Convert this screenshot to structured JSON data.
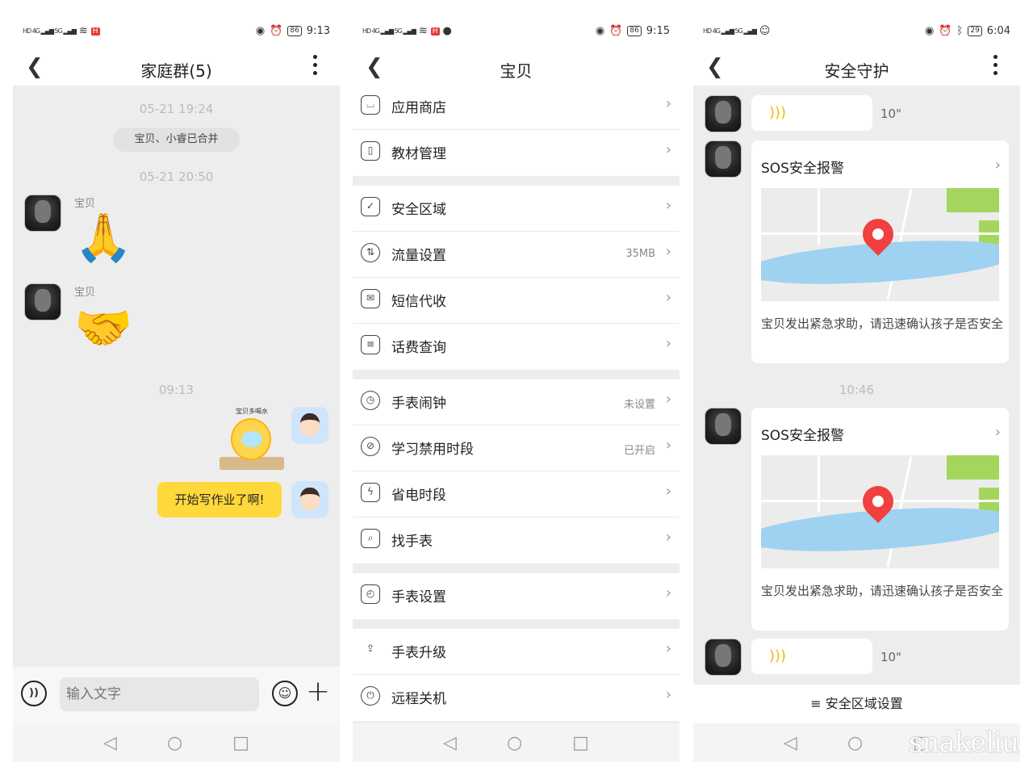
{
  "panel1": {
    "status": {
      "net": "4G",
      "battery": "86",
      "time": "9:13"
    },
    "header": {
      "back": "<",
      "title": "家庭群(5)"
    },
    "timestamps": [
      "05-21 19:24",
      "05-21 20:50",
      "09:13"
    ],
    "system_message": "宝贝、小睿已合并",
    "messages": [
      {
        "sender": "宝贝",
        "emoji": "🙏"
      },
      {
        "sender": "宝贝",
        "emoji": "🤝"
      }
    ],
    "sticker_caption": "宝贝多喝水",
    "my_text": "开始写作业了啊!",
    "input_placeholder": "输入文字"
  },
  "panel2": {
    "status": {
      "net": "4G",
      "battery": "86",
      "time": "9:15"
    },
    "header": {
      "back": "<",
      "title": "宝贝"
    },
    "groups": [
      [
        {
          "label": "应用商店",
          "value": "",
          "icon": "store-icon"
        },
        {
          "label": "教材管理",
          "value": "",
          "icon": "book-icon"
        }
      ],
      [
        {
          "label": "安全区域",
          "value": "",
          "icon": "shield-icon"
        },
        {
          "label": "流量设置",
          "value": "35MB",
          "icon": "traffic-icon"
        },
        {
          "label": "短信代收",
          "value": "",
          "icon": "mail-icon"
        },
        {
          "label": "话费查询",
          "value": "",
          "icon": "bill-icon"
        }
      ],
      [
        {
          "label": "手表闹钟",
          "value": "未设置",
          "icon": "alarm-icon"
        },
        {
          "label": "学习禁用时段",
          "value": "已开启",
          "icon": "ban-icon"
        },
        {
          "label": "省电时段",
          "value": "",
          "icon": "battery-icon"
        },
        {
          "label": "找手表",
          "value": "",
          "icon": "find-icon"
        }
      ],
      [
        {
          "label": "手表设置",
          "value": "",
          "icon": "watch-icon"
        }
      ],
      [
        {
          "label": "手表升级",
          "value": "",
          "icon": "upgrade-icon"
        },
        {
          "label": "远程关机",
          "value": "",
          "icon": "power-icon"
        }
      ]
    ]
  },
  "panel3": {
    "status": {
      "battery": "29",
      "time": "6:04"
    },
    "header": {
      "back": "<",
      "title": "安全守护"
    },
    "voice_duration": "10\"",
    "sos_title": "SOS安全报警",
    "sos_desc": "宝贝发出紧急求助，请迅速确认孩子是否安全",
    "timestamp": "10:46",
    "footer": "≡ 安全区域设置"
  },
  "arrow": "›",
  "watermark": "snakeliu",
  "colors": {
    "accent": "#ffd83c",
    "pin": "#f04040",
    "river": "#9fd2f0",
    "park": "#a4d65e"
  }
}
